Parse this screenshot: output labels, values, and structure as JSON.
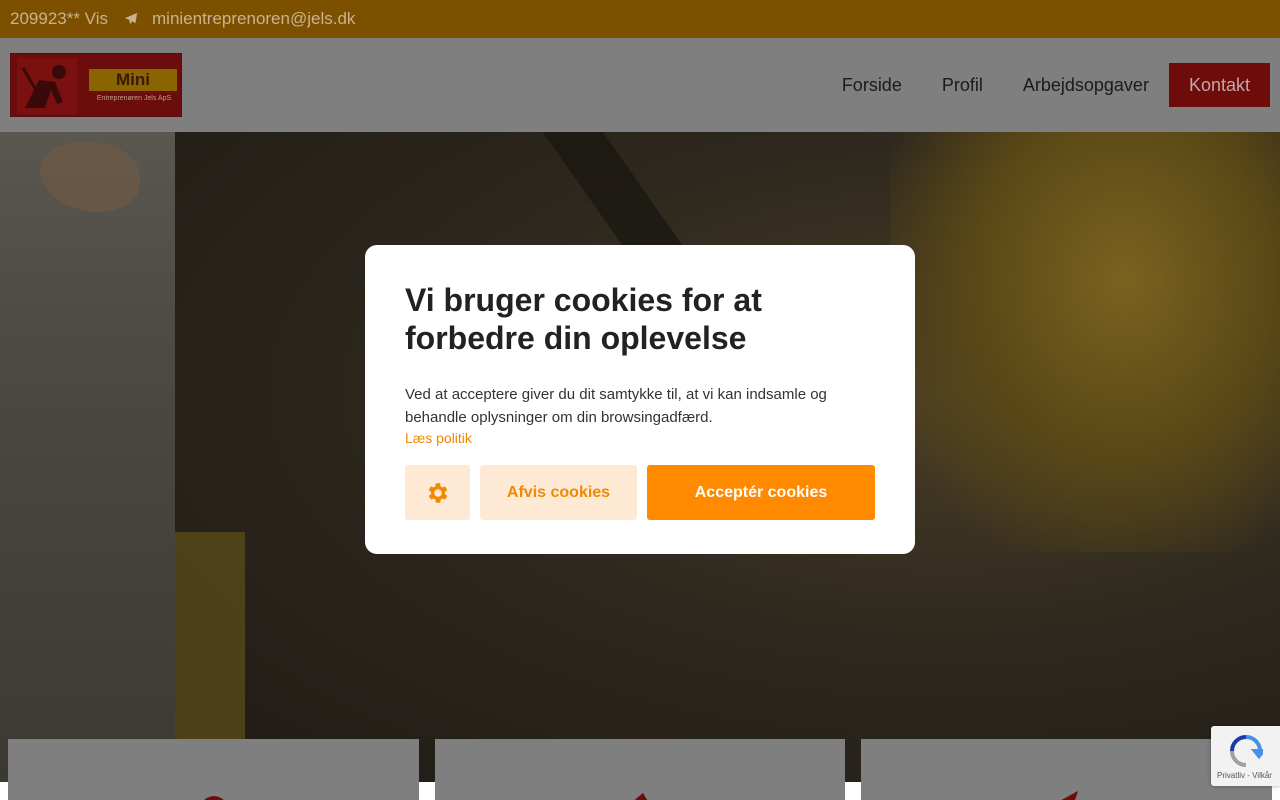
{
  "topbar": {
    "phone": "209923** Vis",
    "email": "minientreprenoren@jels.dk",
    "mail_icon": "paper-plane-icon"
  },
  "header": {
    "logo": {
      "mini": "Mini",
      "tagline": "Entreprenøren Jels ApS"
    },
    "nav": [
      {
        "label": "Forside"
      },
      {
        "label": "Profil"
      },
      {
        "label": "Arbejdsopgaver"
      },
      {
        "label": "Kontakt"
      }
    ]
  },
  "cookie_modal": {
    "title": "Vi bruger cookies for at forbedre din oplevelse",
    "body": "Ved at acceptere giver du dit samtykke til, at vi kan indsamle og behandle oplysninger om din browsingadfærd.",
    "policy_link": "Læs politik",
    "settings_icon": "gear-icon",
    "decline_label": "Afvis cookies",
    "accept_label": "Acceptér cookies"
  },
  "recaptcha": {
    "links": "Privatliv - Vilkår"
  },
  "colors": {
    "accent_orange": "#ff8a00",
    "cta_red": "#c00000"
  }
}
